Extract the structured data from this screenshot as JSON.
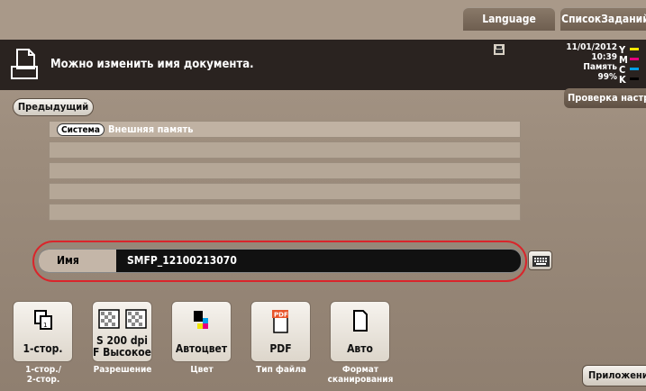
{
  "top": {
    "language_label": "Language",
    "jobs_label": "СписокЗаданий"
  },
  "message": {
    "text": "Можно изменить имя документа."
  },
  "status": {
    "date": "11/01/2012",
    "time": "10:39",
    "memory_label": "Память",
    "memory_value": "99%"
  },
  "toner": [
    {
      "letter": "Y",
      "color": "#f2e600"
    },
    {
      "letter": "M",
      "color": "#e6007e"
    },
    {
      "letter": "C",
      "color": "#00a0e9"
    },
    {
      "letter": "K",
      "color": "#000000"
    }
  ],
  "nav": {
    "prev_label": "Предыдущий",
    "check_label": "Проверка настро"
  },
  "list": {
    "tag": "Система",
    "first_row": "Внешняя память"
  },
  "name": {
    "label": "Имя",
    "value": "SMFP_12100213070"
  },
  "tiles": [
    {
      "value": "1-стор.",
      "label": "1-стор./\n2-стор.",
      "icon": "duplex-icon"
    },
    {
      "value": "S 200 dpi\nF Высокое",
      "label": "Разрешение",
      "icon": "resolution-icon"
    },
    {
      "value": "Автоцвет",
      "label": "Цвет",
      "icon": "color-icon"
    },
    {
      "value": "PDF",
      "label": "Тип файла",
      "icon": "pdf-file-icon"
    },
    {
      "value": "Авто",
      "label": "Формат\nсканирования",
      "icon": "page-size-icon"
    }
  ],
  "app_label": "Приложение",
  "colors": {
    "highlight_ring": "#d9252b",
    "header_bg": "#2a2320"
  }
}
